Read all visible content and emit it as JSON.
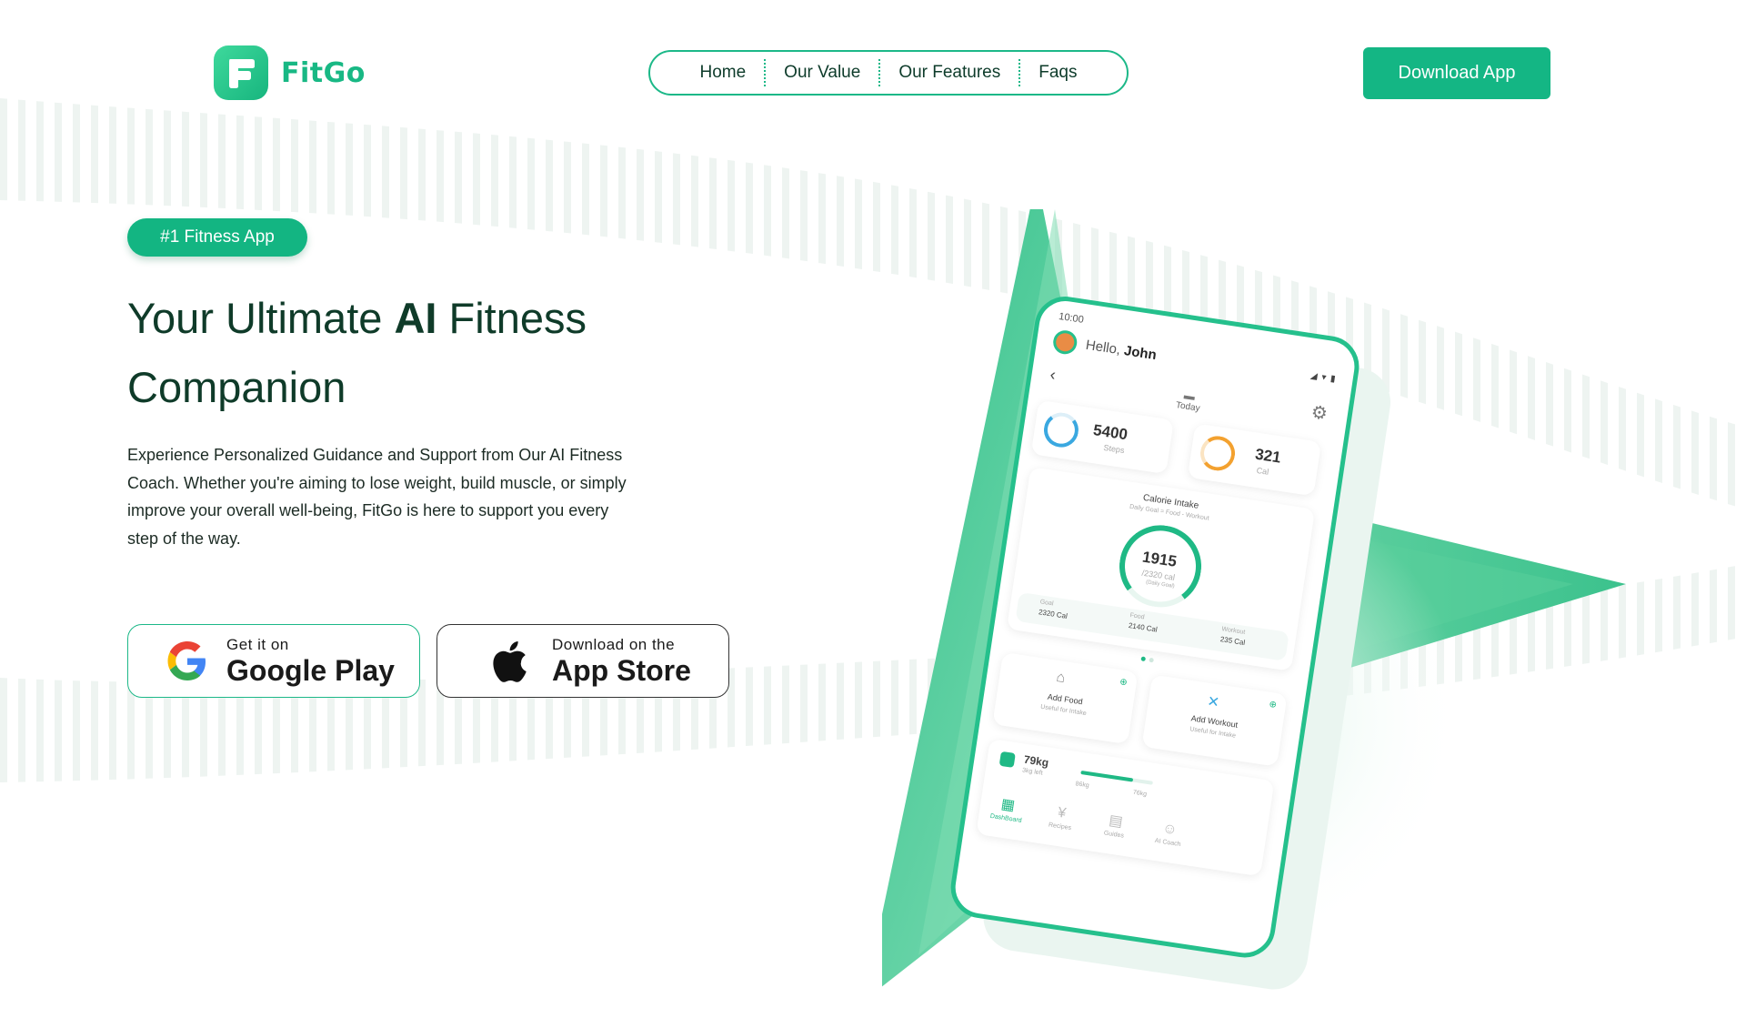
{
  "brand": {
    "name": "FitGo",
    "logo_letter": "F"
  },
  "nav": {
    "items": [
      "Home",
      "Our Value",
      "Our Features",
      "Faqs"
    ]
  },
  "header": {
    "download_label": "Download App"
  },
  "hero": {
    "badge": "#1 Fitness App",
    "headline_prefix": "Your Ultimate ",
    "headline_bold": "AI",
    "headline_suffix": " Fitness Companion",
    "description": "Experience Personalized Guidance and Support from Our AI Fitness Coach. Whether you're aiming to lose weight, build muscle, or simply improve your overall well-being, FitGo is here to support you every step of the way."
  },
  "stores": {
    "google_small": "Get it on",
    "google_big": "Google Play",
    "apple_small": "Download on the",
    "apple_big": "App Store"
  },
  "phone": {
    "time": "10:00",
    "greeting": "Hello,",
    "user": "John",
    "today": "Today",
    "steps_value": "5400",
    "steps_label": "Steps",
    "cal_value": "321",
    "cal_label": "Cal",
    "intake_title": "Calorie Intake",
    "intake_subtitle": "Daily Goal = Food - Workout",
    "intake_value": "1915",
    "intake_goal": "/2320 cal",
    "intake_goal_label": "(Daily Goal)",
    "goal_label": "Goal",
    "goal_value": "2320 Cal",
    "food_label": "Food",
    "food_value": "2140 Cal",
    "workout_label": "Workout",
    "workout_value": "235 Cal",
    "add_food": "Add Food",
    "add_food_sub": "Useful for Intake",
    "add_workout": "Add Workout",
    "add_workout_sub": "Useful for Intake",
    "weight_value": "79kg",
    "weight_left": "3kg left",
    "weight_start": "86kg",
    "weight_target": "76kg",
    "weight_progress": 0.72,
    "tabs": [
      "DashBoard",
      "Recipes",
      "Guides",
      "AI Coach"
    ]
  },
  "colors": {
    "accent": "#14b684",
    "dark_text": "#0f3b29",
    "stripe": "#e9f1ee"
  },
  "icons": [
    "logo-icon",
    "google-play-icon",
    "apple-icon",
    "gear-icon",
    "back-icon",
    "calendar-icon",
    "steps-icon",
    "flame-icon",
    "bell-icon",
    "dumbbell-icon",
    "scale-icon",
    "dashboard-icon",
    "fork-knife-icon",
    "book-icon",
    "robot-icon"
  ]
}
